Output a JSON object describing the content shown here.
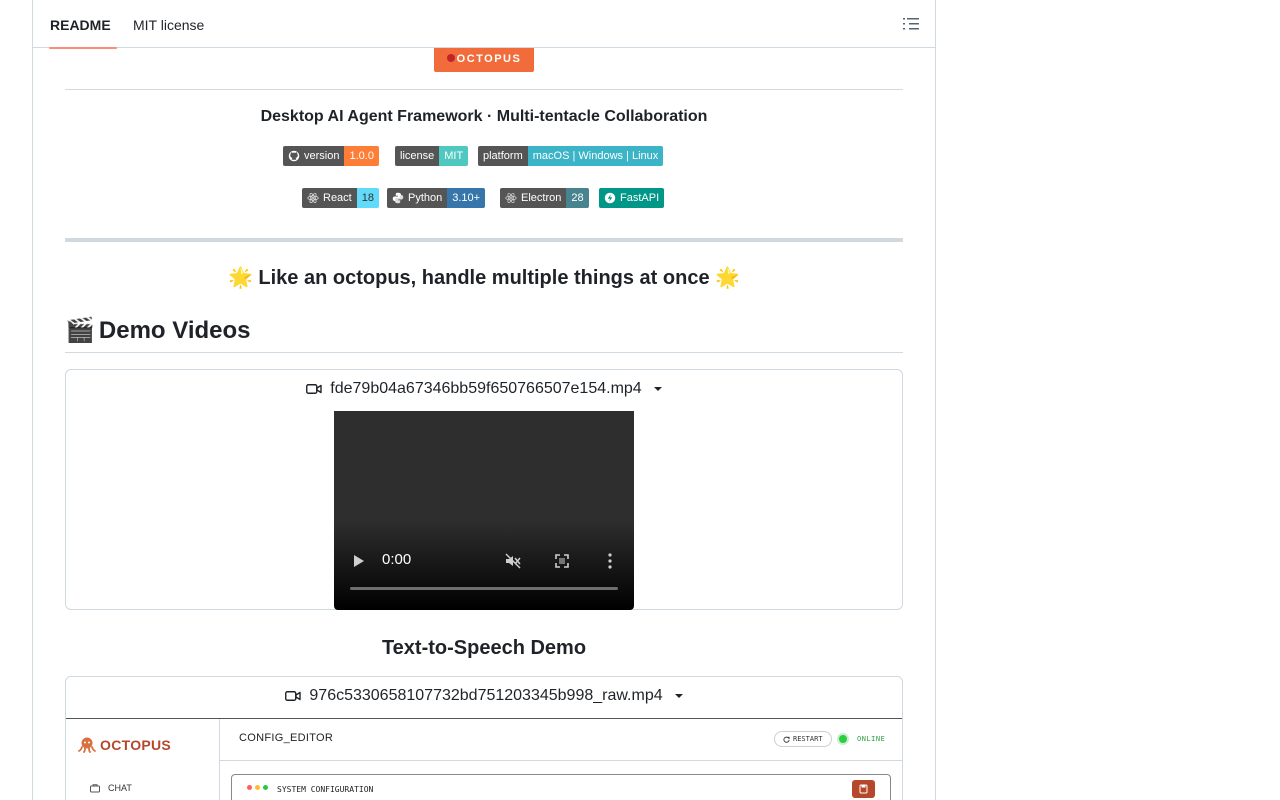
{
  "tabs": [
    {
      "label": "README",
      "active": true
    },
    {
      "label": "MIT license",
      "active": false
    }
  ],
  "logo_strip": "OCTOPUS",
  "subtitle": "Desktop AI Agent Framework · Multi-tentacle Collaboration",
  "badges_row1": [
    {
      "label": "version",
      "value": "1.0.0",
      "color": "#fe7d37",
      "icon": "github-icon"
    },
    {
      "label": "license",
      "value": "MIT",
      "color": "#4fc9c0",
      "icon": ""
    },
    {
      "label": "platform",
      "value": "macOS | Windows | Linux",
      "color": "#3cb4c8",
      "icon": ""
    }
  ],
  "badges_row2": [
    {
      "label": "React",
      "value": "18",
      "color": "#61dafb",
      "icon": "react-icon"
    },
    {
      "label": "Python",
      "value": "3.10+",
      "color": "#3776ab",
      "icon": "python-icon"
    },
    {
      "label": "Electron",
      "value": "28",
      "color": "#47848f",
      "icon": "electron-icon"
    },
    {
      "label": "",
      "value": "FastAPI",
      "color": "#009688",
      "icon": "fastapi-icon"
    }
  ],
  "tagline": "🌟 Like an octopus, handle multiple things at once 🌟",
  "demo_heading": {
    "emoji": "🎬",
    "text": "Demo Videos"
  },
  "video1": {
    "filename": "fde79b04a67346bb59f650766507e154.mp4",
    "time": "0:00"
  },
  "tts_heading": "Text-to-Speech Demo",
  "video2": {
    "filename": "976c5330658107732bd751203345b998_raw.mp4"
  },
  "app_preview": {
    "logo": "OCTOPUS",
    "nav_item": "CHAT",
    "header_title": "CONFIG_EDITOR",
    "restart_label": "RESTART",
    "status_label": "ONLINE",
    "card_title": "SYSTEM CONFIGURATION",
    "brand_color": "#b5482b"
  }
}
